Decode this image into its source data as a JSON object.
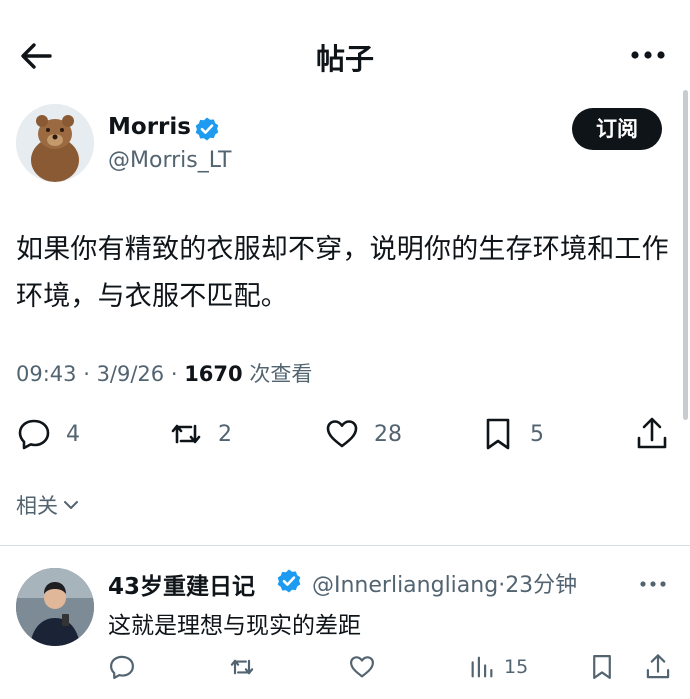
{
  "header": {
    "title": "帖子"
  },
  "post": {
    "author_name": "Morris",
    "author_handle": "@Morris_LT",
    "subscribe_label": "订阅",
    "text": "如果你有精致的衣服却不穿，说明你的生存环境和工作环境，与衣服不匹配。",
    "time": "09:43",
    "date": "3/9/26",
    "views": "1670",
    "views_label": "次查看",
    "separator": " · ",
    "stats": {
      "replies": "4",
      "reposts": "2",
      "likes": "28",
      "bookmarks": "5"
    }
  },
  "related_label": "相关",
  "reply": {
    "author_name": "43岁重建日记",
    "author_handle": "@Innerliangliang",
    "separator": "·",
    "time_ago": "23分钟",
    "text": "这就是理想与现实的差距",
    "views": "15"
  },
  "colors": {
    "verified": "#1d9bf0",
    "muted": "#536471",
    "text": "#0f1419"
  }
}
